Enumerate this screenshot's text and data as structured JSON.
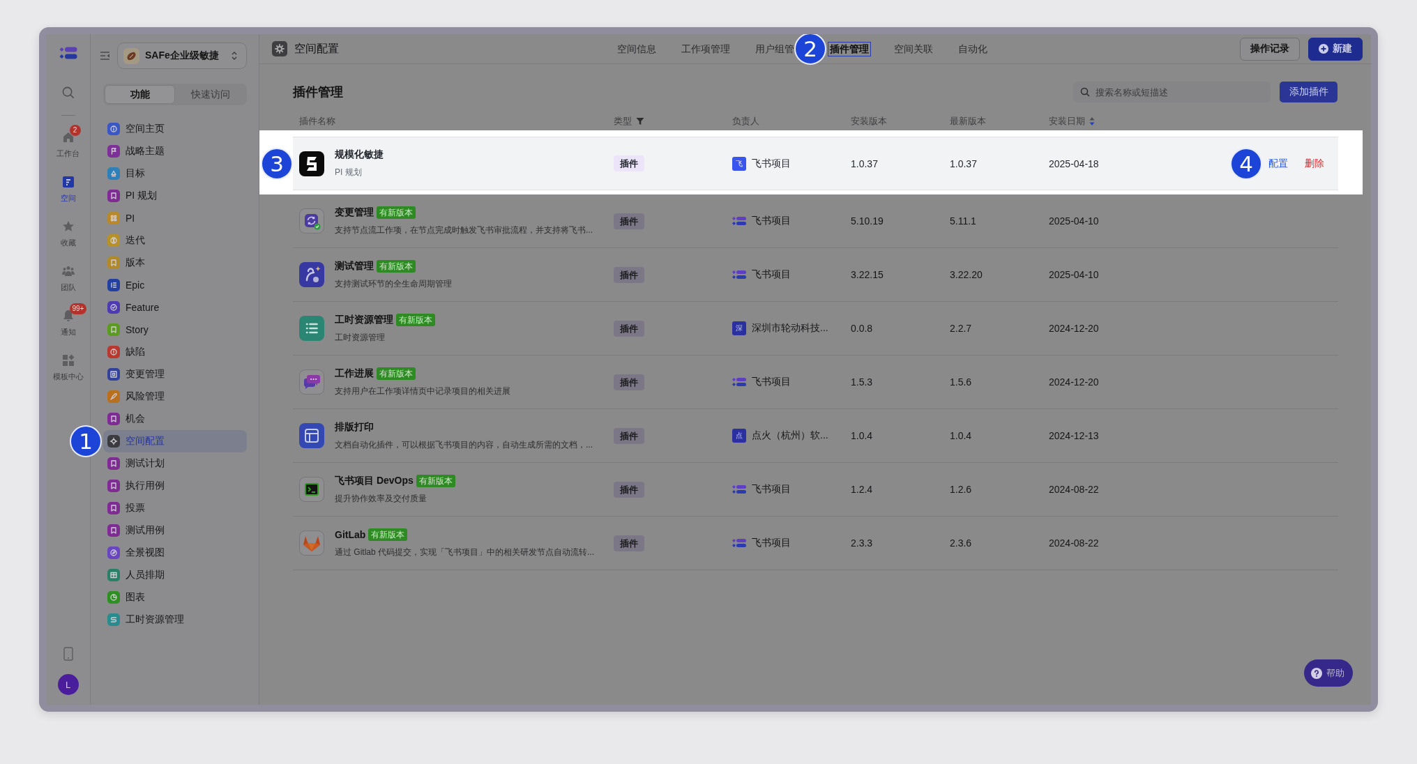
{
  "app_rail": {
    "items": [
      {
        "label": "工作台",
        "selected": false,
        "badge": "2"
      },
      {
        "label": "空间",
        "selected": true
      },
      {
        "label": "收藏",
        "selected": false
      },
      {
        "label": "团队",
        "selected": false
      },
      {
        "label": "通知",
        "selected": false,
        "badge": "99+"
      },
      {
        "label": "模板中心",
        "selected": false
      }
    ],
    "avatar": "L"
  },
  "sidebar": {
    "space": "SAFe企业级敏捷",
    "segments": [
      {
        "label": "功能",
        "selected": true
      },
      {
        "label": "快速访问",
        "selected": false
      }
    ],
    "items": [
      {
        "label": "空间主页",
        "color": "#3b57c4",
        "selected": false
      },
      {
        "label": "战略主题",
        "color": "#7f2f9a",
        "selected": false
      },
      {
        "label": "目标",
        "color": "#2f7fb8",
        "selected": false
      },
      {
        "label": "PI 规划",
        "color": "#7e2c93",
        "selected": false
      },
      {
        "label": "PI",
        "color": "#b8892a",
        "selected": false
      },
      {
        "label": "迭代",
        "color": "#b8902a",
        "selected": false
      },
      {
        "label": "版本",
        "color": "#b08a2a",
        "selected": false
      },
      {
        "label": "Epic",
        "color": "#24409e",
        "selected": false
      },
      {
        "label": "Feature",
        "color": "#4f3bb0",
        "selected": false
      },
      {
        "label": "Story",
        "color": "#5d9a22",
        "selected": false
      },
      {
        "label": "缺陷",
        "color": "#b83a2e",
        "selected": false
      },
      {
        "label": "变更管理",
        "color": "#34419a",
        "selected": false
      },
      {
        "label": "风险管理",
        "color": "#b8701f",
        "selected": false
      },
      {
        "label": "机会",
        "color": "#7e2c93",
        "selected": false
      },
      {
        "label": "空间配置",
        "color": "#3c3c40",
        "selected": true,
        "callout": "1"
      },
      {
        "label": "测试计划",
        "color": "#7e2c93",
        "selected": false
      },
      {
        "label": "执行用例",
        "color": "#7e2c93",
        "selected": false
      },
      {
        "label": "投票",
        "color": "#7e2c93",
        "selected": false
      },
      {
        "label": "测试用例",
        "color": "#7e2c93",
        "selected": false
      },
      {
        "label": "全景视图",
        "color": "#6a45c0",
        "selected": false
      },
      {
        "label": "人员排期",
        "color": "#2a8066",
        "selected": false
      },
      {
        "label": "图表",
        "color": "#2f8f22",
        "selected": false
      },
      {
        "label": "工时资源管理",
        "color": "#2a8a8e",
        "selected": false
      }
    ]
  },
  "header": {
    "title": "空间配置",
    "tabs": [
      {
        "label": "空间信息",
        "selected": false
      },
      {
        "label": "工作项管理",
        "selected": false
      },
      {
        "label": "用户组管",
        "selected": false
      },
      {
        "label": "插件管理",
        "selected": true,
        "callout": "2"
      },
      {
        "label": "空间关联",
        "selected": false
      },
      {
        "label": "自动化",
        "selected": false
      }
    ],
    "buttons": [
      {
        "label": "操作记录",
        "kind": "secondary"
      },
      {
        "label": "新建",
        "kind": "primary"
      }
    ]
  },
  "page": {
    "title": "插件管理",
    "search": {
      "placeholder": "搜索名称或短描述"
    },
    "add_button": "添加插件"
  },
  "table": {
    "columns": [
      {
        "label": "插件名称"
      },
      {
        "label": "类型",
        "filter": true
      },
      {
        "label": "负责人"
      },
      {
        "label": "安装版本"
      },
      {
        "label": "最新版本"
      },
      {
        "label": "安装日期",
        "sort_descending": true
      }
    ],
    "rows": [
      {
        "name": "规模化敏捷",
        "description": "PI 规划",
        "type": "插件",
        "owner": {
          "name": "飞书项目",
          "kind": "letter",
          "letter": "飞"
        },
        "installed": "1.0.37",
        "latest": "1.0.37",
        "install_date": "2025-04-18",
        "highlighted": true,
        "callout": "3",
        "actions": [
          {
            "label": "配置",
            "kind": "edit",
            "callout": "4"
          },
          {
            "label": "删除",
            "kind": "danger"
          }
        ]
      },
      {
        "name": "变更管理",
        "update_tag": "有新版本",
        "description": "支持节点流工作项，在节点完成时触发飞书审批流程，并支持将飞书...",
        "type": "插件",
        "owner": {
          "name": "飞书项目",
          "kind": "logo"
        },
        "installed": "5.10.19",
        "latest": "5.11.1",
        "install_date": "2025-04-10",
        "highlighted": false
      },
      {
        "name": "测试管理",
        "update_tag": "有新版本",
        "description": "支持测试环节的全生命周期管理",
        "type": "插件",
        "owner": {
          "name": "飞书项目",
          "kind": "logo"
        },
        "installed": "3.22.15",
        "latest": "3.22.20",
        "install_date": "2025-04-10",
        "highlighted": false
      },
      {
        "name": "工时资源管理",
        "update_tag": "有新版本",
        "description": "工时资源管理",
        "type": "插件",
        "owner": {
          "name": "深圳市轮动科技...",
          "kind": "letter",
          "letter": "深"
        },
        "installed": "0.0.8",
        "latest": "2.2.7",
        "install_date": "2024-12-20",
        "highlighted": false
      },
      {
        "name": "工作进展",
        "update_tag": "有新版本",
        "description": "支持用户在工作项详情页中记录项目的相关进展",
        "type": "插件",
        "owner": {
          "name": "飞书项目",
          "kind": "logo"
        },
        "installed": "1.5.3",
        "latest": "1.5.6",
        "install_date": "2024-12-20",
        "highlighted": false
      },
      {
        "name": "排版打印",
        "description": "文档自动化插件，可以根据飞书项目的内容，自动生成所需的文档，...",
        "type": "插件",
        "owner": {
          "name": "点火（杭州）软...",
          "kind": "letter",
          "letter": "点"
        },
        "installed": "1.0.4",
        "latest": "1.0.4",
        "install_date": "2024-12-13",
        "highlighted": false
      },
      {
        "name": "飞书项目 DevOps",
        "update_tag": "有新版本",
        "description": "提升协作效率及交付质量",
        "type": "插件",
        "owner": {
          "name": "飞书项目",
          "kind": "logo"
        },
        "installed": "1.2.4",
        "latest": "1.2.6",
        "install_date": "2024-08-22",
        "highlighted": false
      },
      {
        "name": "GitLab",
        "update_tag": "有新版本",
        "description": "通过 Gitlab 代码提交，实现「飞书项目」中的相关研发节点自动流转...",
        "type": "插件",
        "owner": {
          "name": "飞书项目",
          "kind": "logo"
        },
        "installed": "2.3.3",
        "latest": "2.3.6",
        "install_date": "2024-08-22",
        "highlighted": false
      }
    ]
  },
  "help_button": "帮助"
}
